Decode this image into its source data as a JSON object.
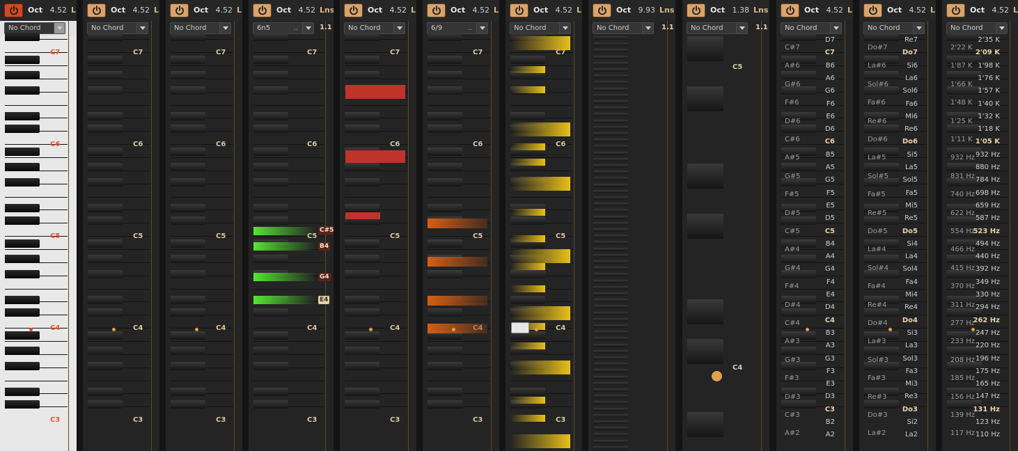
{
  "colors": {
    "gold": "#d9a36b",
    "red": "#c0332b",
    "green": "#48d62a",
    "orange": "#d06018",
    "yellow": "#e8c01a"
  },
  "panels": [
    {
      "id": "p1",
      "oct_label": "Oct",
      "oct_value": "4.52",
      "extra": "L",
      "chord": "No Chord",
      "style": "light",
      "c_labels": [
        "C7",
        "C6",
        "C5",
        "C4",
        "C3"
      ]
    },
    {
      "id": "p2",
      "oct_label": "Oct",
      "oct_value": "4.52",
      "extra": "L",
      "chord": "No Chord",
      "style": "dark",
      "c_labels": [
        "C7",
        "C6",
        "C5",
        "C4",
        "C3"
      ]
    },
    {
      "id": "p3",
      "oct_label": "Oct",
      "oct_value": "4.52",
      "extra": "L",
      "chord": "No Chord",
      "style": "dark",
      "c_labels": [
        "C7",
        "C6",
        "C5",
        "C4",
        "C3"
      ]
    },
    {
      "id": "p4",
      "oct_label": "Oct",
      "oct_value": "4.52",
      "extra": "Lns",
      "chord": "6n5",
      "style": "dark",
      "c_labels": [
        "C7",
        "C6",
        "C5",
        "C4",
        "C3"
      ],
      "strip_top": "1.1",
      "strip_tags": [
        "C#5",
        "B4",
        "G4",
        "E4"
      ]
    },
    {
      "id": "p5",
      "oct_label": "Oct",
      "oct_value": "4.52",
      "extra": "L",
      "chord": "No Chord",
      "style": "dark",
      "c_labels": [
        "C7",
        "C6",
        "C5",
        "C4",
        "C3"
      ]
    },
    {
      "id": "p6",
      "oct_label": "Oct",
      "oct_value": "4.52",
      "extra": "L",
      "chord": "6/9",
      "style": "dark",
      "c_labels": [
        "C7",
        "C6",
        "C5",
        "C4",
        "C3"
      ]
    },
    {
      "id": "p7",
      "oct_label": "Oct",
      "oct_value": "4.52",
      "extra": "L",
      "chord": "No Chord",
      "style": "dark",
      "c_labels": [
        "C7",
        "C6",
        "C5",
        "C4",
        "C3"
      ]
    },
    {
      "id": "p8",
      "oct_label": "Oct",
      "oct_value": "9.93",
      "extra": "Lns",
      "chord": "No Chord",
      "style": "dark",
      "strip_top": "1.1"
    },
    {
      "id": "p9",
      "oct_label": "Oct",
      "oct_value": "1.38",
      "extra": "Lns",
      "chord": "No Chord",
      "style": "dark",
      "c_labels": [
        "C5",
        "C4"
      ],
      "strip_top": "1.1"
    },
    {
      "id": "p10",
      "oct_label": "Oct",
      "oct_value": "4.52",
      "extra": "L",
      "chord": "No Chord",
      "style": "dark",
      "notes": [
        "D7",
        "C7",
        "B6",
        "A6",
        "G6",
        "F6",
        "E6",
        "D6",
        "C6",
        "B5",
        "A5",
        "G5",
        "F5",
        "E5",
        "D5",
        "C5",
        "B4",
        "A4",
        "G4",
        "F4",
        "E4",
        "D4",
        "C4",
        "B3",
        "A3",
        "G3",
        "F3",
        "E3",
        "D3",
        "C3",
        "B2",
        "A2"
      ],
      "sharps": [
        "C#7",
        "A#6",
        "G#6",
        "F#6",
        "D#6",
        "C#6",
        "A#5",
        "G#5",
        "F#5",
        "D#5",
        "C#5",
        "A#4",
        "G#4",
        "F#4",
        "D#4",
        "C#4",
        "A#3",
        "G#3",
        "F#3",
        "D#3",
        "C#3",
        "A#2"
      ]
    },
    {
      "id": "p11",
      "oct_label": "Oct",
      "oct_value": "4.52",
      "extra": "L",
      "chord": "No Chord",
      "style": "dark",
      "notes": [
        "Re7",
        "Do7",
        "Si6",
        "La6",
        "Sol6",
        "Fa6",
        "Mi6",
        "Re6",
        "Do6",
        "Si5",
        "La5",
        "Sol5",
        "Fa5",
        "Mi5",
        "Re5",
        "Do5",
        "Si4",
        "La4",
        "Sol4",
        "Fa4",
        "Mi4",
        "Re4",
        "Do4",
        "Si3",
        "La3",
        "Sol3",
        "Fa3",
        "Mi3",
        "Re3",
        "Do3",
        "Si2",
        "La2"
      ],
      "sharps": [
        "Do#7",
        "La#6",
        "Sol#6",
        "Fa#6",
        "Re#6",
        "Do#6",
        "La#5",
        "Sol#5",
        "Fa#5",
        "Re#5",
        "Do#5",
        "La#4",
        "Sol#4",
        "Fa#4",
        "Re#4",
        "Do#4",
        "La#3",
        "Sol#3",
        "Fa#3",
        "Re#3",
        "Do#3",
        "La#2"
      ]
    },
    {
      "id": "p12",
      "oct_label": "Oct",
      "oct_value": "4.52",
      "extra": "L",
      "chord": "No Chord",
      "style": "dark",
      "notes": [
        "2'35 K",
        "2'09 K",
        "1'98 K",
        "1'76 K",
        "1'57 K",
        "1'40 K",
        "1'32 K",
        "1'18 K",
        "1'05 K",
        "932 Hz",
        "880 Hz",
        "784 Hz",
        "698 Hz",
        "659 Hz",
        "587 Hz",
        "523 Hz",
        "494 Hz",
        "440 Hz",
        "392 Hz",
        "349 Hz",
        "330 Hz",
        "294 Hz",
        "262 Hz",
        "247 Hz",
        "220 Hz",
        "196 Hz",
        "175 Hz",
        "165 Hz",
        "147 Hz",
        "131 Hz",
        "123 Hz",
        "110 Hz"
      ],
      "sharps": [
        "2'22 K",
        "1'87 K",
        "1'66 K",
        "1'48 K",
        "1'25 K",
        "1'11 K",
        "932 Hz",
        "831 Hz",
        "740 Hz",
        "622 Hz",
        "554 Hz",
        "466 Hz",
        "415 Hz",
        "370 Hz",
        "311 Hz",
        "277 Hz",
        "233 Hz",
        "208 Hz",
        "185 Hz",
        "156 Hz",
        "139 Hz",
        "117 Hz"
      ]
    }
  ]
}
